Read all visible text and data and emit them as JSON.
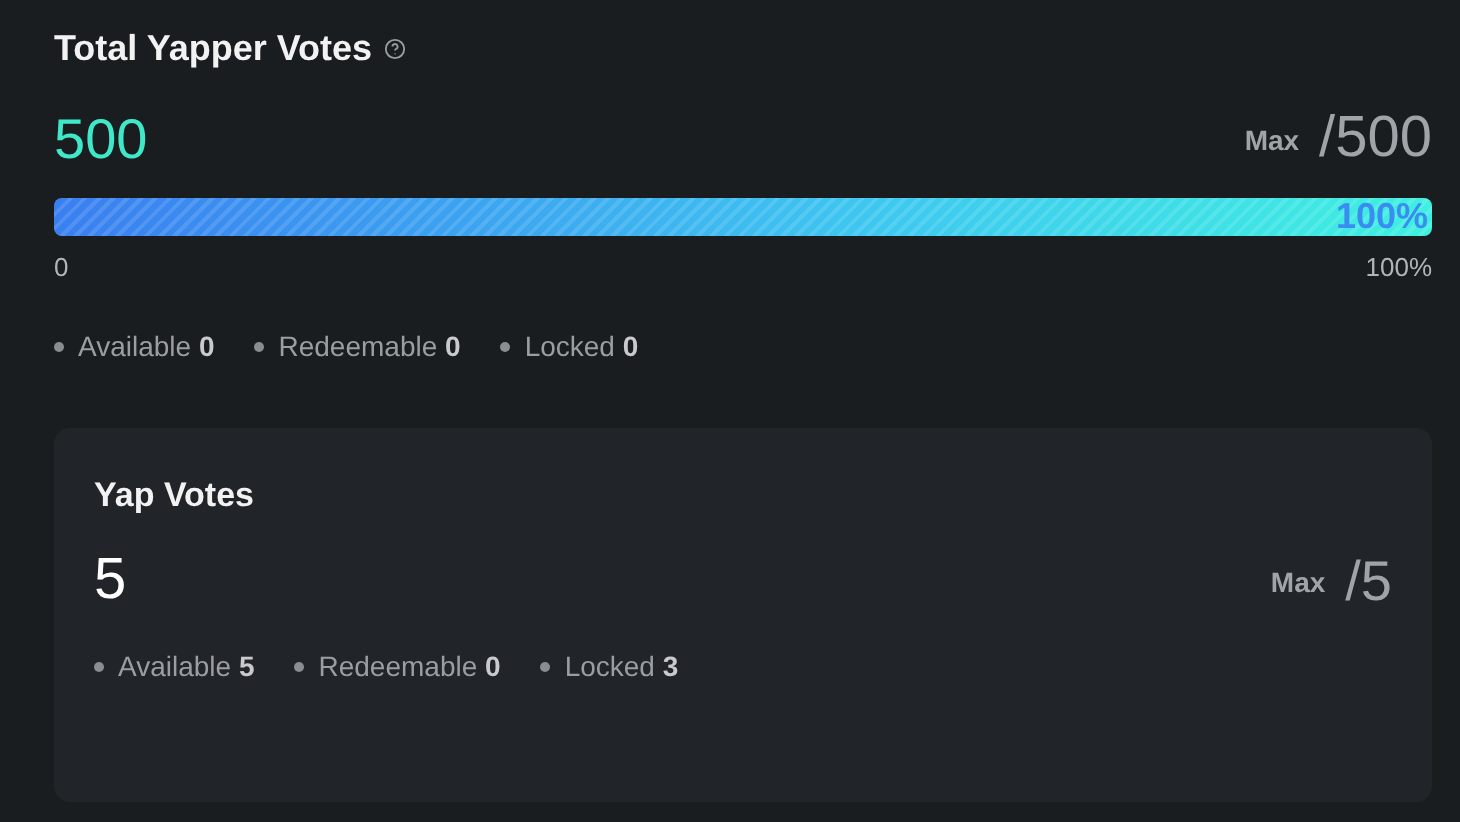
{
  "total": {
    "title": "Total Yapper Votes",
    "value": "500",
    "max_label": "Max",
    "max_value": "/500",
    "level": 1,
    "bar_label": "100%",
    "scale_start": "0",
    "scale_end": "100%",
    "stats": [
      {
        "label": "Available",
        "value": "0"
      },
      {
        "label": "Redeemable",
        "value": "0"
      },
      {
        "label": "Locked",
        "value": "0"
      }
    ]
  },
  "card": {
    "title": "Yap Votes",
    "value": "5",
    "max_label": "Max",
    "max_value": "/5",
    "stats": [
      {
        "label": "Available",
        "value": "5"
      },
      {
        "label": "Redeemable",
        "value": "0"
      },
      {
        "label": "Locked",
        "value": "3"
      }
    ]
  }
}
